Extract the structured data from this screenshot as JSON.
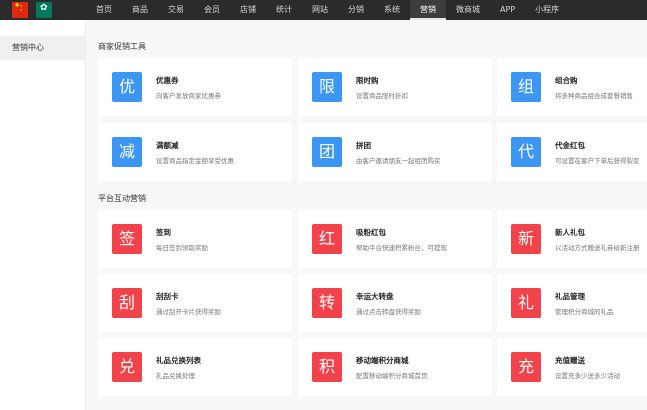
{
  "nav": {
    "items": [
      "首页",
      "商品",
      "交易",
      "会员",
      "店铺",
      "统计",
      "网站",
      "分销",
      "系统",
      "营销",
      "微商城",
      "APP",
      "小程序"
    ],
    "active": "营销"
  },
  "sidebar": {
    "items": [
      {
        "label": "营销中心"
      }
    ]
  },
  "sections": [
    {
      "title": "商家促销工具",
      "cards": [
        {
          "icon": "优",
          "name": "优惠券",
          "desc": "向客户发放商家优惠券"
        },
        {
          "icon": "限",
          "name": "限时购",
          "desc": "设置商品限时折扣"
        },
        {
          "icon": "组",
          "name": "组合购",
          "desc": "将多种商品组合成套餐销售"
        },
        {
          "icon": "减",
          "name": "满额减",
          "desc": "设置商品指定金额享受优惠"
        },
        {
          "icon": "团",
          "name": "拼团",
          "desc": "由客户邀请朋友一起组团购买"
        },
        {
          "icon": "代",
          "name": "代金红包",
          "desc": "可设置在客户下单后获得裂变"
        }
      ]
    },
    {
      "title": "平台互动营销",
      "cards": [
        {
          "icon": "签",
          "name": "签到",
          "desc": "每日签到领取奖励"
        },
        {
          "icon": "红",
          "name": "吸粉红包",
          "desc": "帮助平台快速积累粉丝，可提现"
        },
        {
          "icon": "新",
          "name": "新人礼包",
          "desc": "以活动方式赠送礼券给新注册"
        },
        {
          "icon": "刮",
          "name": "刮刮卡",
          "desc": "通过刮开卡片获得奖励"
        },
        {
          "icon": "转",
          "name": "幸运大转盘",
          "desc": "通过点击转盘获得奖励"
        },
        {
          "icon": "礼",
          "name": "礼品管理",
          "desc": "管理积分商城的礼品"
        },
        {
          "icon": "兑",
          "name": "礼品兑换列表",
          "desc": "礼品兑换处理"
        },
        {
          "icon": "积",
          "name": "移动端积分商城",
          "desc": "配置移动端积分商城首页"
        },
        {
          "icon": "充",
          "name": "充值赠送",
          "desc": "设置充多少送多少活动"
        }
      ]
    }
  ],
  "colors": {
    "blue_icon": "#3c97f4",
    "red_icon": "#f2434b",
    "topbar": "#2b2b2b"
  }
}
